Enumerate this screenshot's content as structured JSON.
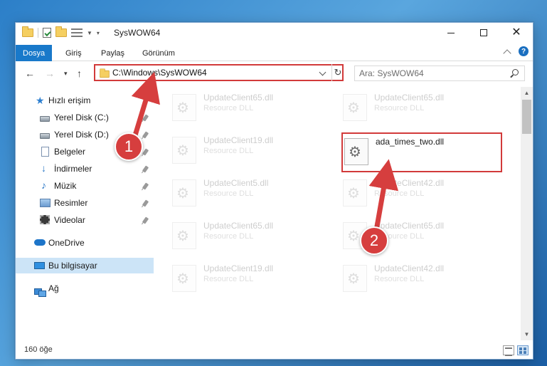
{
  "window": {
    "title": "SysWOW64",
    "controls": {
      "minimize": "minimize-icon",
      "maximize": "maximize-icon",
      "close": "close-icon"
    }
  },
  "ribbon": {
    "tabs": [
      {
        "label": "Dosya",
        "active": true
      },
      {
        "label": "Giriş",
        "active": false
      },
      {
        "label": "Paylaş",
        "active": false
      },
      {
        "label": "Görünüm",
        "active": false
      }
    ],
    "help": "?"
  },
  "address": {
    "path": "C:\\Windows\\SysWOW64",
    "search_placeholder": "Ara: SysWOW64"
  },
  "nav": {
    "items": [
      {
        "label": "Hızlı erişim",
        "icon": "star-icon"
      },
      {
        "label": "Yerel Disk (C:)",
        "icon": "drive-icon",
        "pinned": true
      },
      {
        "label": "Yerel Disk (D:)",
        "icon": "drive-icon",
        "pinned": true
      },
      {
        "label": "Belgeler",
        "icon": "documents-icon",
        "pinned": true
      },
      {
        "label": "İndirmeler",
        "icon": "downloads-icon",
        "pinned": true
      },
      {
        "label": "Müzik",
        "icon": "music-icon",
        "pinned": true
      },
      {
        "label": "Resimler",
        "icon": "pictures-icon",
        "pinned": true
      },
      {
        "label": "Videolar",
        "icon": "videos-icon",
        "pinned": true
      },
      {
        "label": "OneDrive",
        "icon": "onedrive-icon"
      },
      {
        "label": "Bu bilgisayar",
        "icon": "this-pc-icon",
        "selected": true
      },
      {
        "label": "Ağ",
        "icon": "network-icon"
      }
    ]
  },
  "files": [
    {
      "name": "UpdateClient65.dll",
      "type": "Resource DLL",
      "faded": true
    },
    {
      "name": "UpdateClient65.dll",
      "type": "Resource DLL",
      "faded": true
    },
    {
      "name": "UpdateClient19.dll",
      "type": "Resource DLL",
      "faded": true
    },
    {
      "name": "ada_times_two.dll",
      "type": "",
      "faded": false,
      "highlighted": true
    },
    {
      "name": "UpdateClient5.dll",
      "type": "Resource DLL",
      "faded": true
    },
    {
      "name": "UpdateClient42.dll",
      "type": "Resource DLL",
      "faded": true
    },
    {
      "name": "UpdateClient65.dll",
      "type": "Resource DLL",
      "faded": true
    },
    {
      "name": "UpdateClient65.dll",
      "type": "Resource DLL",
      "faded": true
    },
    {
      "name": "UpdateClient19.dll",
      "type": "Resource DLL",
      "faded": true
    },
    {
      "name": "UpdateClient42.dll",
      "type": "Resource DLL",
      "faded": true
    }
  ],
  "status": {
    "count": "160 öğe"
  },
  "annotations": {
    "accent_color": "#d63e3e",
    "steps": [
      {
        "label": "1"
      },
      {
        "label": "2"
      }
    ]
  }
}
